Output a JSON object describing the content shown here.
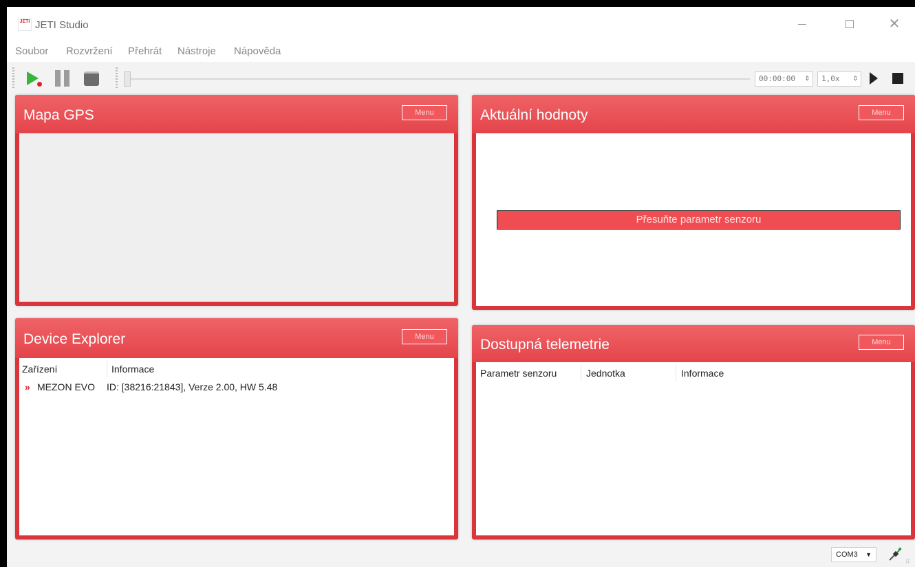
{
  "window": {
    "title": "JETI Studio",
    "logo_text": "JETI"
  },
  "menubar": {
    "items": [
      "Soubor",
      "Rozvržení",
      "Přehrát",
      "Nástroje",
      "Nápověda"
    ]
  },
  "toolbar": {
    "time_value": "00:00:00",
    "speed_value": "1,0x",
    "spin_arrows": "⇕"
  },
  "panels": {
    "gps": {
      "title": "Mapa GPS",
      "menu_label": "Menu"
    },
    "values": {
      "title": "Aktuální hodnoty",
      "menu_label": "Menu",
      "drop_hint": "Přesuňte parametr senzoru"
    },
    "devices": {
      "title": "Device Explorer",
      "menu_label": "Menu",
      "columns": [
        "Zařízení",
        "Informace"
      ],
      "rows": [
        {
          "marker": "»",
          "device": "MEZON EVO",
          "info": "ID: [38216:21843], Verze 2.00, HW 5.48"
        }
      ]
    },
    "telemetry": {
      "title": "Dostupná telemetrie",
      "menu_label": "Menu",
      "columns": [
        "Parametr senzoru",
        "Jednotka",
        "Informace"
      ]
    }
  },
  "statusbar": {
    "port": "COM3",
    "dropdown_arrow": "▼"
  },
  "colors": {
    "panel_header": "#e4444a",
    "panel_border": "#d9353a",
    "accent_red": "#d9262a",
    "play_green": "#38b43a"
  }
}
